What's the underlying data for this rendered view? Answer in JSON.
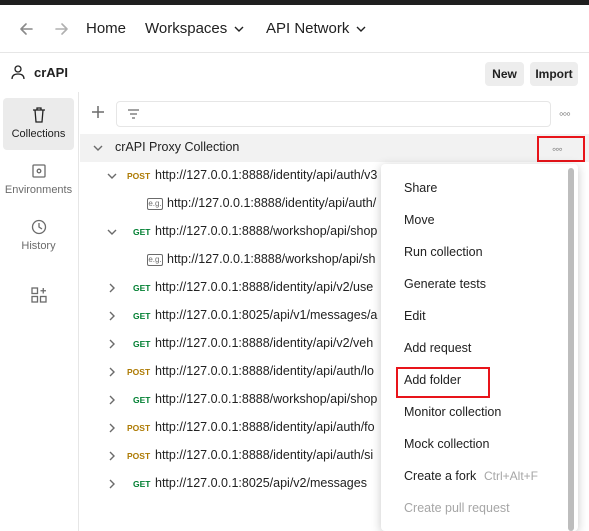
{
  "topbar": {
    "back_icon": "arrow-left-icon",
    "forward_icon": "arrow-right-icon",
    "home_label": "Home",
    "workspaces_label": "Workspaces",
    "api_network_label": "API Network"
  },
  "workspace": {
    "name": "crAPI",
    "new_label": "New",
    "import_label": "Import"
  },
  "sidebar": {
    "collections_label": "Collections",
    "environments_label": "Environments",
    "history_label": "History"
  },
  "collection": {
    "name": "crAPI Proxy Collection",
    "rows": [
      {
        "method": "POST",
        "url": "http://127.0.0.1:8888/identity/api/auth/v3"
      },
      {
        "method": "",
        "url": "http://127.0.0.1:8888/identity/api/auth/"
      },
      {
        "method": "GET",
        "url": "http://127.0.0.1:8888/workshop/api/shop"
      },
      {
        "method": "",
        "url": "http://127.0.0.1:8888/workshop/api/sh"
      },
      {
        "method": "GET",
        "url": "http://127.0.0.1:8888/identity/api/v2/use"
      },
      {
        "method": "GET",
        "url": "http://127.0.0.1:8025/api/v1/messages/a"
      },
      {
        "method": "GET",
        "url": "http://127.0.0.1:8888/identity/api/v2/veh"
      },
      {
        "method": "POST",
        "url": "http://127.0.0.1:8888/identity/api/auth/lo"
      },
      {
        "method": "GET",
        "url": "http://127.0.0.1:8888/workshop/api/shop"
      },
      {
        "method": "POST",
        "url": "http://127.0.0.1:8888/identity/api/auth/fo"
      },
      {
        "method": "POST",
        "url": "http://127.0.0.1:8888/identity/api/auth/si"
      },
      {
        "method": "GET",
        "url": "http://127.0.0.1:8025/api/v2/messages"
      }
    ],
    "example_badge": "e.g."
  },
  "menu": {
    "items": [
      "Share",
      "Move",
      "Run collection",
      "Generate tests",
      "Edit",
      "Add request",
      "Add folder",
      "Monitor collection",
      "Mock collection",
      "Create a fork",
      "Create pull request"
    ],
    "fork_shortcut": "Ctrl+Alt+F"
  }
}
